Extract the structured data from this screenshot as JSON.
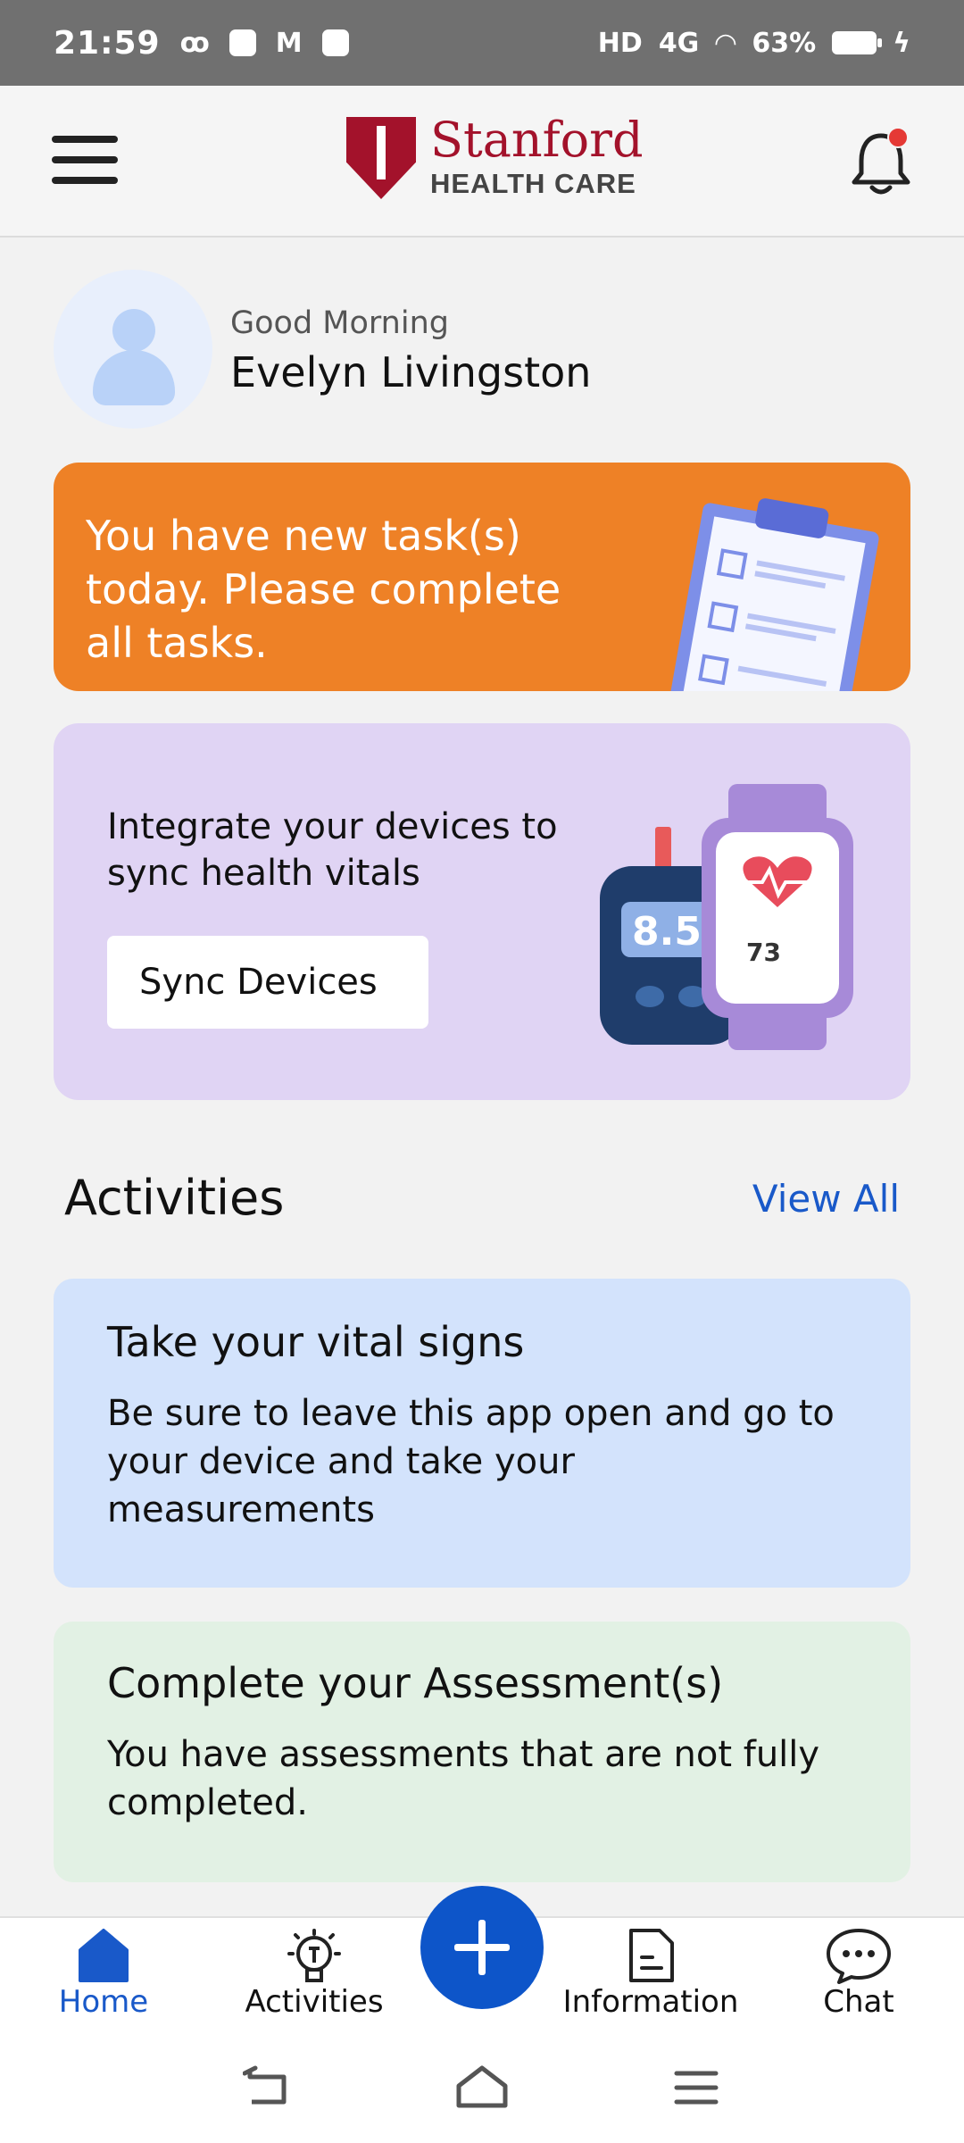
{
  "status_bar": {
    "time": "21:59",
    "network": "4G",
    "battery": "63%"
  },
  "header": {
    "brand_name": "Stanford",
    "brand_sub": "HEALTH CARE",
    "notification_dot_color": "#e53935"
  },
  "greeting": {
    "salutation": "Good Morning",
    "name": "Evelyn Livingston"
  },
  "task_banner": {
    "text": "You have new task(s) today. Please complete all tasks.",
    "color": "#ee8126"
  },
  "sync_card": {
    "text": "Integrate your devices to sync health vitals",
    "button_label": "Sync Devices",
    "glucose_reading": "8.5",
    "heart_rate": "73"
  },
  "activities": {
    "title": "Activities",
    "view_all_label": "View All",
    "items": [
      {
        "title": "Take your vital signs",
        "description": "Be sure to leave this app open and go to your device and take your measurements",
        "color": "#d3e3fc"
      },
      {
        "title": "Complete your Assessment(s)",
        "description": "You have assessments that are not fully completed.",
        "color": "#e2f1e4"
      }
    ]
  },
  "bottom_nav": {
    "items": [
      {
        "label": "Home",
        "icon": "home-icon",
        "active": true
      },
      {
        "label": "Activities",
        "icon": "lightbulb-icon"
      },
      {
        "label": "Information",
        "icon": "document-icon"
      },
      {
        "label": "Chat",
        "icon": "chat-bubble-icon"
      }
    ],
    "accent": "#1959c9"
  }
}
